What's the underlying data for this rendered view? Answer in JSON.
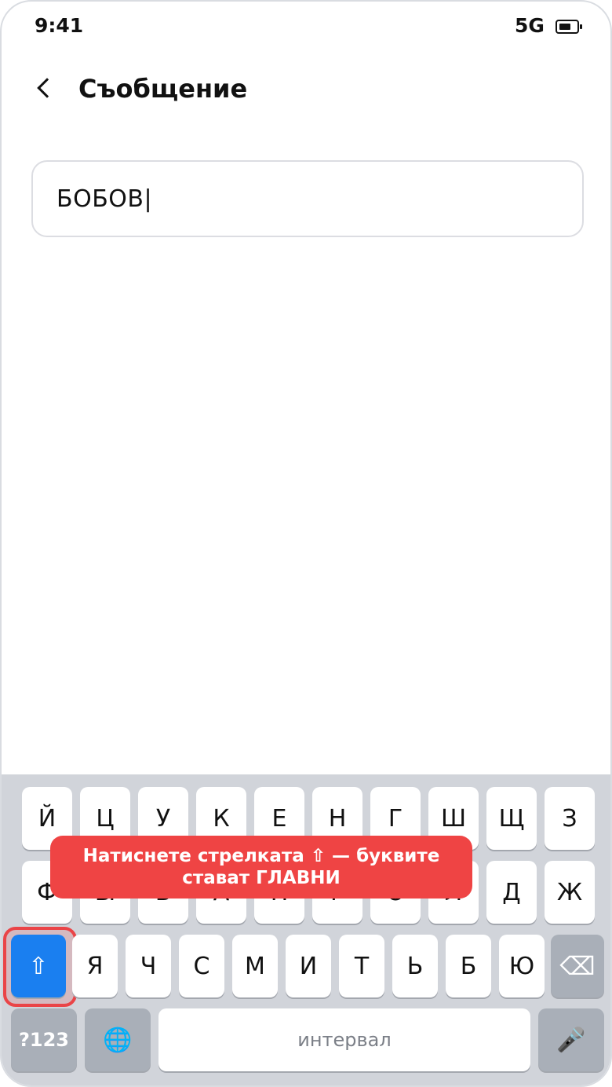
{
  "status_bar": {
    "time": "9:41",
    "network": "5G",
    "battery_icon": "battery-icon"
  },
  "header": {
    "back_icon": "chevron-left-icon",
    "title": "Съобщение"
  },
  "message": {
    "value": "БОБОВ",
    "cursor": "|"
  },
  "keyboard": {
    "row1": [
      "Й",
      "Ц",
      "У",
      "К",
      "Е",
      "Н",
      "Г",
      "Ш",
      "Щ",
      "З"
    ],
    "row2": [
      "Ф",
      "Ы",
      "В",
      "А",
      "П",
      "Р",
      "О",
      "Л",
      "Д",
      "Ж"
    ],
    "row3": [
      "Я",
      "Ч",
      "С",
      "М",
      "И",
      "Т",
      "Ь",
      "Б",
      "Ю"
    ],
    "shift_label": "⇧",
    "backspace_label": "⌫",
    "numbers_label": "?123",
    "globe_label": "🌐",
    "space_label": "интервал",
    "mic_label": "🎤"
  },
  "tooltip": {
    "line1": "Натиснете стрелката ⇧ — буквите",
    "line2": "стават ГЛАВНИ"
  },
  "colors": {
    "accent": "#1a7ff0",
    "highlight": "#ef4444",
    "keyboard_bg": "#d1d4da"
  }
}
